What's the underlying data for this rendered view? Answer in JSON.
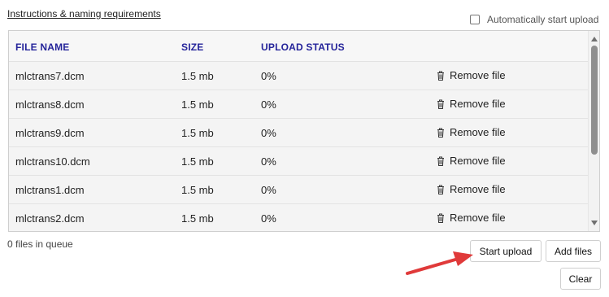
{
  "instructions_link": "Instructions & naming requirements",
  "auto_start": {
    "label": "Automatically start upload",
    "checked": false
  },
  "table": {
    "columns": [
      "FILE NAME",
      "SIZE",
      "UPLOAD STATUS"
    ],
    "rows": [
      {
        "name": "mlctrans7.dcm",
        "size": "1.5 mb",
        "status": "0%",
        "action": "Remove file"
      },
      {
        "name": "mlctrans8.dcm",
        "size": "1.5 mb",
        "status": "0%",
        "action": "Remove file"
      },
      {
        "name": "mlctrans9.dcm",
        "size": "1.5 mb",
        "status": "0%",
        "action": "Remove file"
      },
      {
        "name": "mlctrans10.dcm",
        "size": "1.5 mb",
        "status": "0%",
        "action": "Remove file"
      },
      {
        "name": "mlctrans1.dcm",
        "size": "1.5 mb",
        "status": "0%",
        "action": "Remove file"
      },
      {
        "name": "mlctrans2.dcm",
        "size": "1.5 mb",
        "status": "0%",
        "action": "Remove file"
      }
    ]
  },
  "queue_status": "0 files in queue",
  "buttons": {
    "start_upload": "Start upload",
    "add_files": "Add files",
    "clear": "Clear"
  },
  "icons": {
    "remove": "trash-icon",
    "scroll_up": "arrow-up-icon",
    "scroll_down": "arrow-down-icon",
    "annotation": "red-arrow-icon"
  },
  "colors": {
    "header_text": "#25249a",
    "arrow": "#e03a3a",
    "row_background": "#f4f4f4"
  }
}
